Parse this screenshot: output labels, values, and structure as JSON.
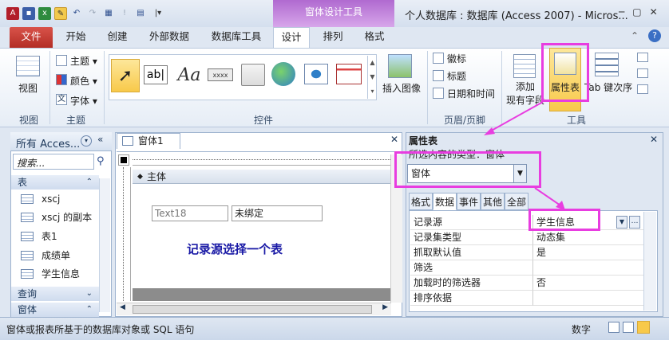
{
  "window": {
    "title": "个人数据库 : 数据库 (Access 2007)  -  Micros...",
    "context_tab_group": "窗体设计工具",
    "controls": [
      "─",
      "▢",
      "✕"
    ]
  },
  "qat": {
    "app_letter": "A",
    "customize": "|▾"
  },
  "tabs": [
    "文件",
    "开始",
    "创建",
    "外部数据",
    "数据库工具",
    "设计",
    "排列",
    "格式"
  ],
  "ribbon": {
    "view": {
      "label": "视图",
      "group": "视图"
    },
    "theme": {
      "items": [
        "主题 ▾",
        "颜色 ▾",
        "字体 ▾"
      ],
      "group": "主题"
    },
    "controls_group": "控件",
    "insert_image": "插入图像",
    "header_footer": {
      "items": [
        "徽标",
        "标题",
        "日期和时间"
      ],
      "group": "页眉/页脚"
    },
    "tools": {
      "add_fields": "添加\n现有字段",
      "property_sheet": "属性表",
      "tab_order": "Tab 键次序",
      "group": "工具"
    },
    "gallery_text_icon": "xxxx"
  },
  "nav": {
    "title": "所有 Acces...",
    "search_placeholder": "搜索...",
    "category_tables": "表",
    "items": [
      "xscj",
      "xscj 的副本",
      "表1",
      "成绩单",
      "学生信息"
    ],
    "category_queries": "查询",
    "category_forms": "窗体"
  },
  "form": {
    "tab_title": "窗体1",
    "section": "主体",
    "textbox_name": "Text18",
    "textbox_value": "未绑定",
    "annotation": "记录源选择一个表"
  },
  "property_sheet": {
    "title": "属性表",
    "selection_label": "所选内容的类型：窗体",
    "selection_value": "窗体",
    "tabs": [
      "格式",
      "数据",
      "事件",
      "其他",
      "全部"
    ],
    "rows": [
      {
        "name": "记录源",
        "value": "学生信息"
      },
      {
        "name": "记录集类型",
        "value": "动态集"
      },
      {
        "name": "抓取默认值",
        "value": "是"
      },
      {
        "name": "筛选",
        "value": ""
      },
      {
        "name": "加载时的筛选器",
        "value": "否"
      },
      {
        "name": "排序依据",
        "value": ""
      }
    ]
  },
  "status": {
    "text": "窗体或报表所基于的数据库对象或 SQL 语句",
    "mode": "数字"
  },
  "colors": {
    "highlight": "#e83de0",
    "context": "#b06ad0",
    "file_tab": "#c0392b",
    "title_text": "#1a1aa6"
  }
}
